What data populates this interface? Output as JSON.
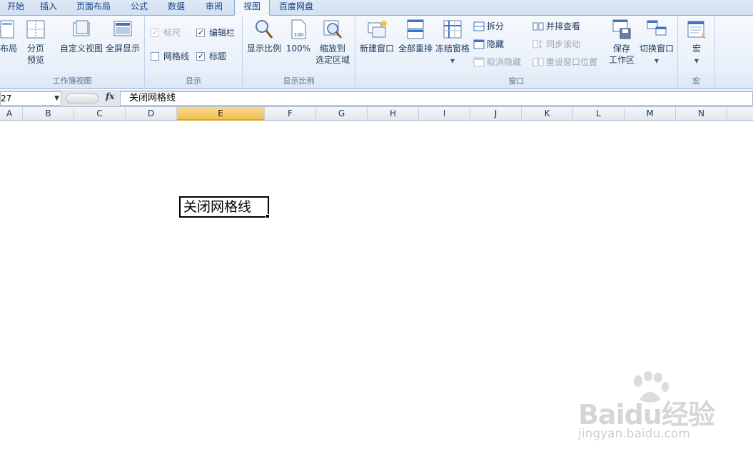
{
  "tabs": [
    {
      "label": "开始",
      "active": false
    },
    {
      "label": "插入",
      "active": false
    },
    {
      "label": "页面布局",
      "active": false
    },
    {
      "label": "公式",
      "active": false
    },
    {
      "label": "数据",
      "active": false
    },
    {
      "label": "审阅",
      "active": false
    },
    {
      "label": "视图",
      "active": true
    },
    {
      "label": "百度网盘",
      "active": false
    }
  ],
  "ribbon": {
    "workbook_views": {
      "label": "工作簿视图",
      "page_layout": "布局",
      "page_break_line1": "分页",
      "page_break_line2": "预览",
      "custom_view": "自定义视图",
      "full_screen": "全屏显示"
    },
    "show": {
      "label": "显示",
      "ruler": "标尺",
      "formula_bar": "编辑栏",
      "gridlines": "网格线",
      "headings": "标题",
      "ruler_checked": true,
      "formula_bar_checked": true,
      "gridlines_checked": false,
      "headings_checked": true
    },
    "zoom": {
      "label": "显示比例",
      "zoom": "显示比例",
      "hundred": "100%",
      "hundred_icon_text": "100",
      "zoom_sel_line1": "缩放到",
      "zoom_sel_line2": "选定区域"
    },
    "window": {
      "label": "窗口",
      "new_window": "新建窗口",
      "arrange_all": "全部重排",
      "freeze_panes": "冻结窗格",
      "split": "拆分",
      "hide": "隐藏",
      "unhide": "取消隐藏",
      "side_by_side": "并排查看",
      "sync_scroll": "同步滚动",
      "reset_position": "重设窗口位置",
      "save_workspace_line1": "保存",
      "save_workspace_line2": "工作区",
      "switch_windows": "切换窗口"
    },
    "macros": {
      "label": "宏",
      "macros": "宏"
    }
  },
  "formula_bar": {
    "name_box": "27",
    "fx": "fx",
    "content": "关闭网格线"
  },
  "columns": [
    "A",
    "B",
    "C",
    "D",
    "E",
    "F",
    "G",
    "H",
    "I",
    "J",
    "K",
    "L",
    "M",
    "N"
  ],
  "selected_column": "E",
  "active_cell": {
    "value": "关闭网格线"
  },
  "watermark": {
    "brand": "Baidu经验",
    "url": "jingyan.baidu.com"
  },
  "colors": {
    "ribbon_bg": "#e9f0f9",
    "tab_text": "#15428b",
    "selected_header": "#f1c15a"
  }
}
